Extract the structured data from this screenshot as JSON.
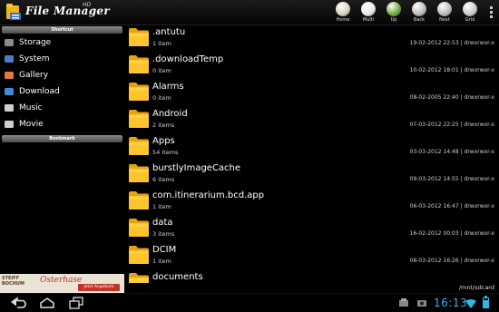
{
  "header": {
    "title": "File Manager",
    "title_sup": "HD"
  },
  "toolbar": [
    {
      "label": "Home",
      "icon": "home-icon",
      "color": "#d8d0c0"
    },
    {
      "label": "Multi",
      "icon": "multi-select-icon",
      "color": "#e8e8e8"
    },
    {
      "label": "Up",
      "icon": "up-arrow-icon",
      "color": "#6ea93a"
    },
    {
      "label": "Back",
      "icon": "back-arrow-icon",
      "color": "#b8b8b8"
    },
    {
      "label": "Next",
      "icon": "next-arrow-icon",
      "color": "#b8b8b8"
    },
    {
      "label": "Grid",
      "icon": "grid-icon",
      "color": "#c8c8c8"
    }
  ],
  "sidebar": {
    "shortcut_header": "Shortcut",
    "bookmark_header": "Bookmark",
    "items": [
      {
        "label": "Storage",
        "icon": "storage-icon"
      },
      {
        "label": "System",
        "icon": "system-icon"
      },
      {
        "label": "Gallery",
        "icon": "gallery-icon"
      },
      {
        "label": "Download",
        "icon": "download-icon"
      },
      {
        "label": "Music",
        "icon": "music-icon"
      },
      {
        "label": "Movie",
        "icon": "movie-icon"
      }
    ]
  },
  "files": [
    {
      "name": ".antutu",
      "count": "1 item",
      "meta": "19-02-2012 22:53 | drwxrwxr-x"
    },
    {
      "name": ".downloadTemp",
      "count": "0 item",
      "meta": "10-02-2012 18:01 | drwxrwxr-x"
    },
    {
      "name": "Alarms",
      "count": "0 item",
      "meta": "08-02-2005 22:40 | drwxrwxr-x"
    },
    {
      "name": "Android",
      "count": "2 items",
      "meta": "07-03-2012 22:25 | drwxrwxr-x"
    },
    {
      "name": "Apps",
      "count": "54 items",
      "meta": "03-03-2012 14:48 | drwxrwxr-x"
    },
    {
      "name": "burstlyImageCache",
      "count": "6 items",
      "meta": "09-03-2012 14:55 | drwxrwxr-x"
    },
    {
      "name": "com.itinerarium.bcd.app",
      "count": "1 item",
      "meta": "06-03-2012 16:47 | drwxrwxr-x"
    },
    {
      "name": "data",
      "count": "3 items",
      "meta": "16-02-2012 00:03 | drwxrwxr-x"
    },
    {
      "name": "DCIM",
      "count": "1 item",
      "meta": "08-03-2012 16:26 | drwxrwxr-x"
    },
    {
      "name": "documents",
      "count": "",
      "meta": ""
    }
  ],
  "path": "/mnt/sdcard",
  "ad": {
    "brand": "STEIFF BOCHUM",
    "headline": "Osterhase",
    "cta": "Jetzt Angebote ansehen!"
  },
  "statusbar": {
    "time": "16:13",
    "battery_level": 0.8,
    "accent": "#33b5e5"
  }
}
